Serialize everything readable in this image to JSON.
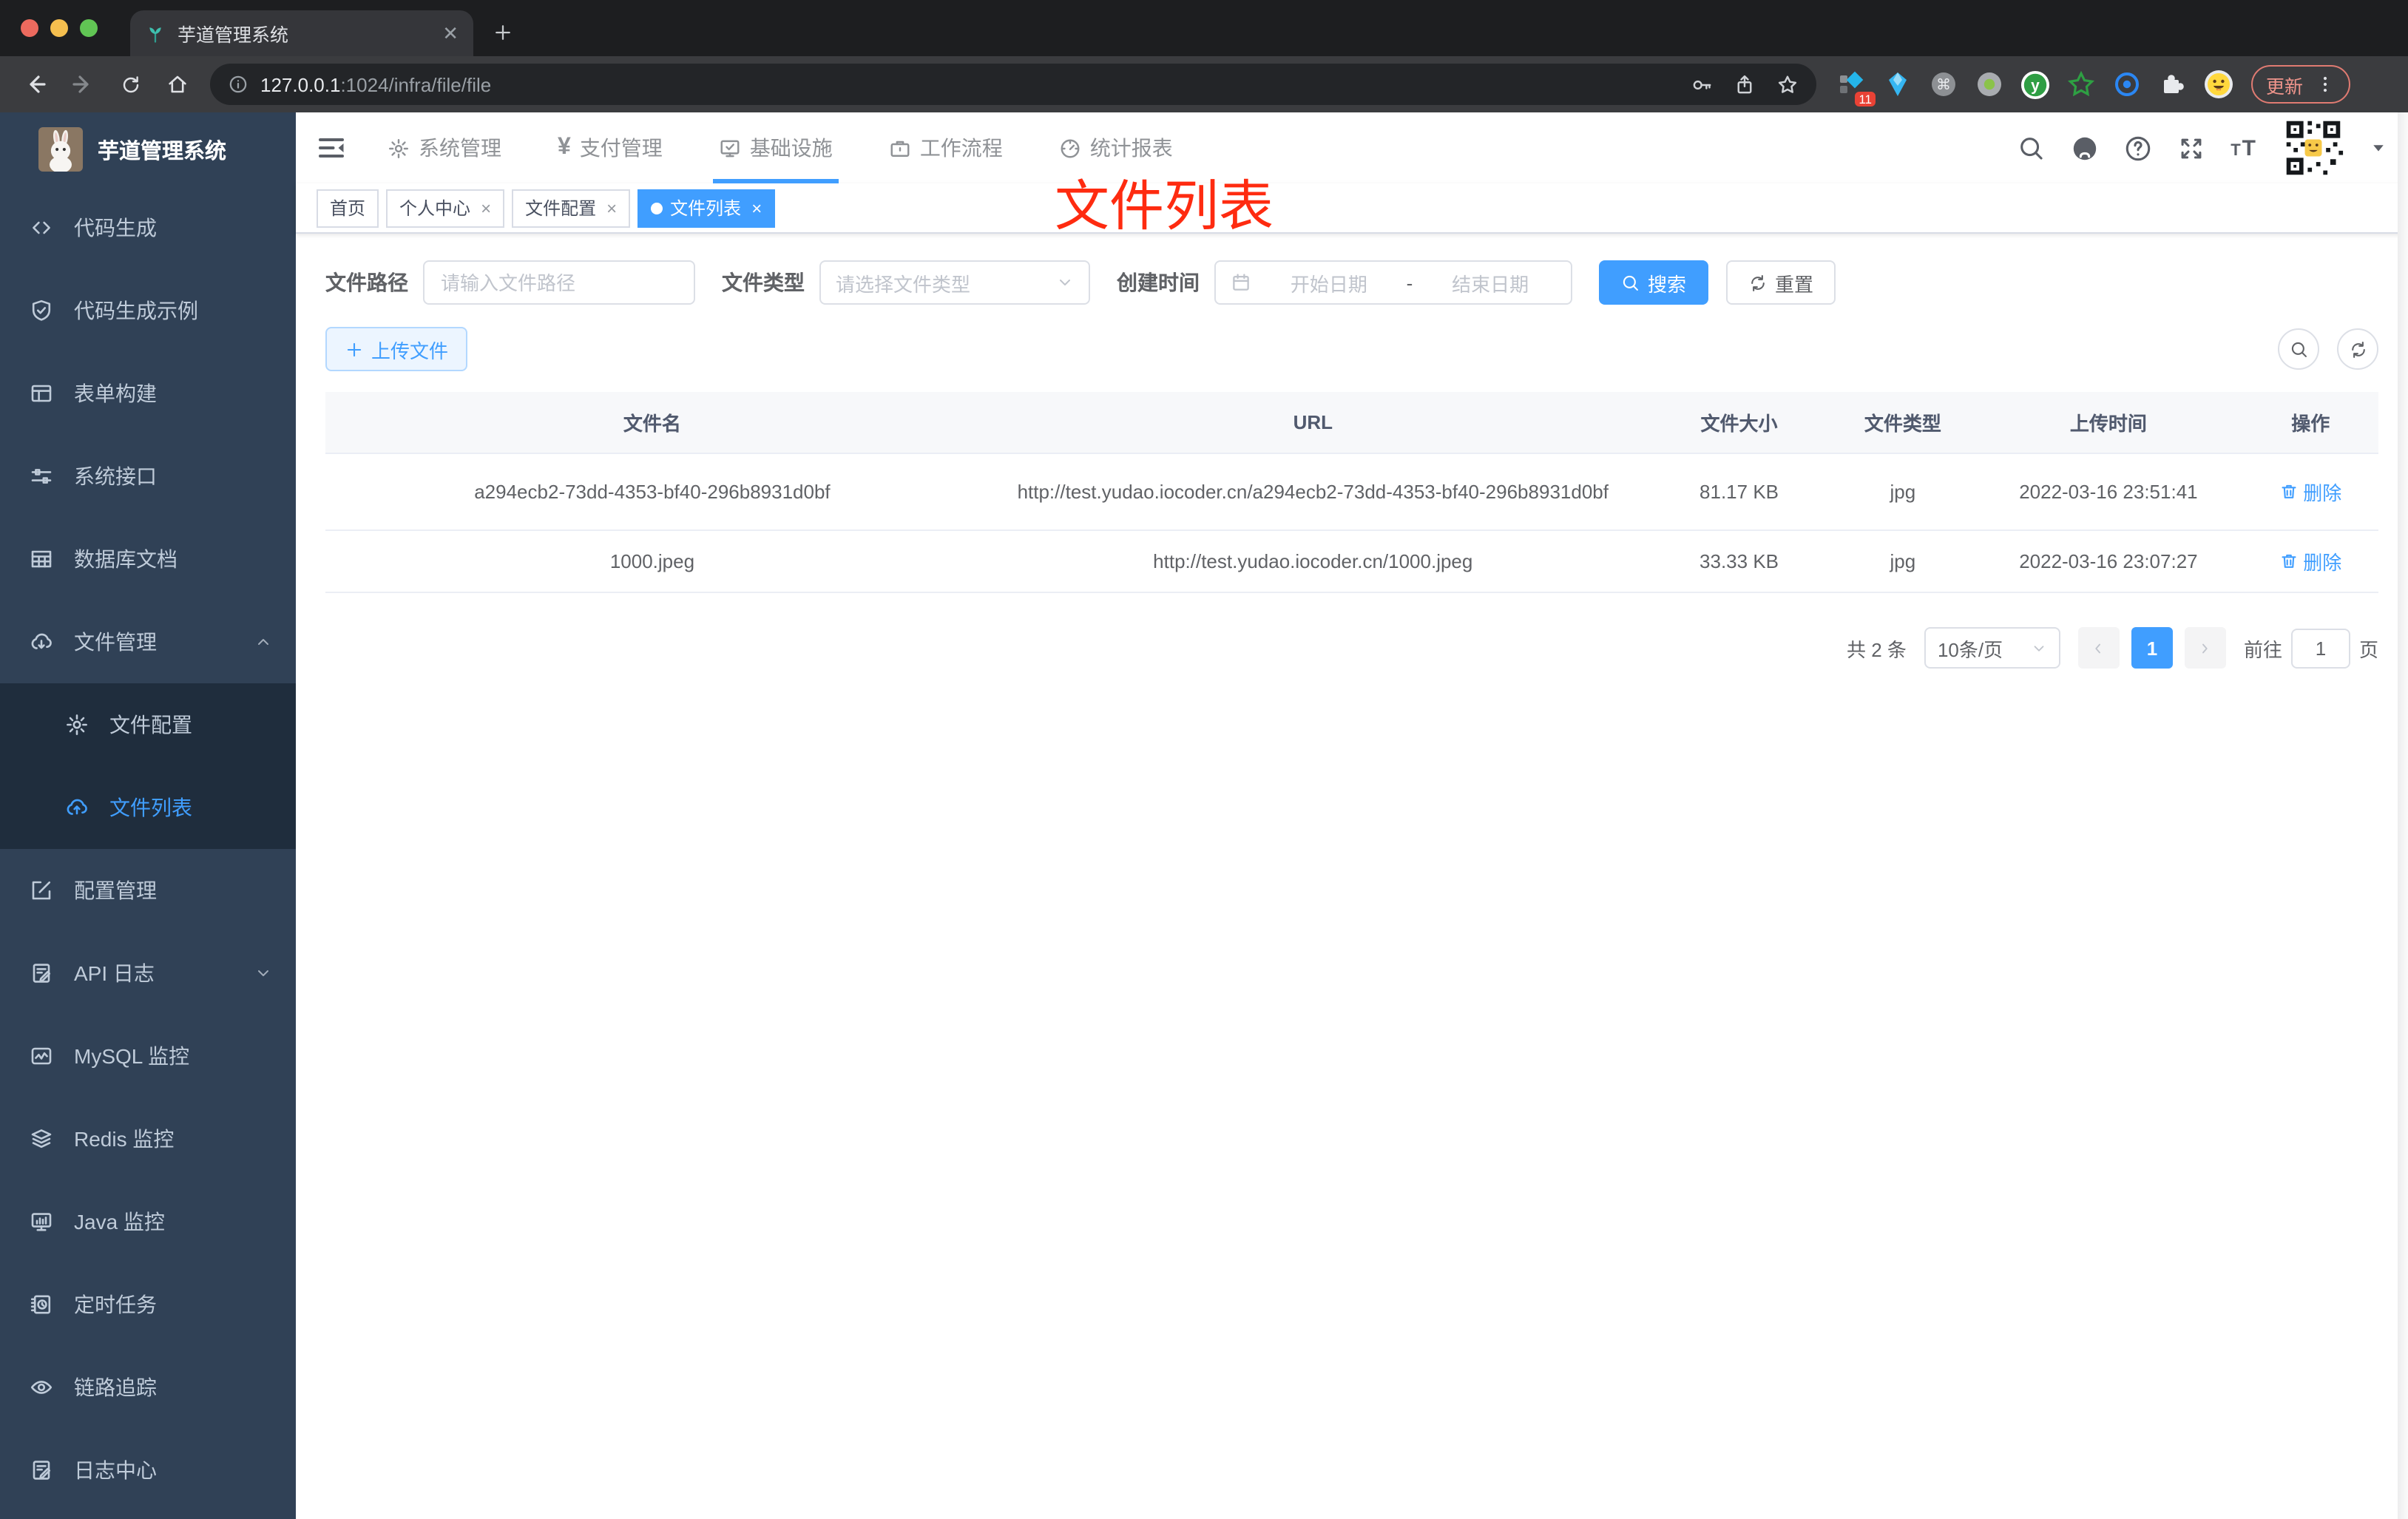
{
  "browser": {
    "tab_title": "芋道管理系统",
    "url_host": "127.0.0.1",
    "url_rest": ":1024/infra/file/file",
    "extensions_badge": "11",
    "update_label": "更新"
  },
  "sidebar": {
    "title": "芋道管理系统",
    "items": [
      {
        "label": "代码生成",
        "icon": "code-icon"
      },
      {
        "label": "代码生成示例",
        "icon": "shield-check-icon"
      },
      {
        "label": "表单构建",
        "icon": "form-icon"
      },
      {
        "label": "系统接口",
        "icon": "sliders-icon"
      },
      {
        "label": "数据库文档",
        "icon": "grid-icon"
      },
      {
        "label": "文件管理",
        "icon": "cloud-download-icon",
        "expanded": true
      },
      {
        "label": "文件配置",
        "icon": "gear-icon",
        "submenu": true
      },
      {
        "label": "文件列表",
        "icon": "cloud-upload-icon",
        "submenu": true,
        "active": true
      },
      {
        "label": "配置管理",
        "icon": "edit-square-icon"
      },
      {
        "label": "API 日志",
        "icon": "log-icon",
        "collapsed": true
      },
      {
        "label": "MySQL 监控",
        "icon": "chart-icon"
      },
      {
        "label": "Redis 监控",
        "icon": "layers-icon"
      },
      {
        "label": "Java 监控",
        "icon": "monitor-icon"
      },
      {
        "label": "定时任务",
        "icon": "schedule-icon"
      },
      {
        "label": "链路追踪",
        "icon": "eye-icon"
      },
      {
        "label": "日志中心",
        "icon": "log-icon"
      }
    ]
  },
  "header": {
    "nav": [
      {
        "label": "系统管理",
        "icon": "gear-icon"
      },
      {
        "label": "支付管理",
        "icon": "yen-icon"
      },
      {
        "label": "基础设施",
        "icon": "infra-icon",
        "active": true
      },
      {
        "label": "工作流程",
        "icon": "briefcase-icon"
      },
      {
        "label": "统计报表",
        "icon": "dashboard-icon"
      }
    ]
  },
  "tags": [
    {
      "label": "首页"
    },
    {
      "label": "个人中心",
      "closable": true
    },
    {
      "label": "文件配置",
      "closable": true
    },
    {
      "label": "文件列表",
      "closable": true,
      "active": true
    }
  ],
  "annotation": {
    "text": "文件列表",
    "color": "#fe2b10"
  },
  "filter": {
    "path_label": "文件路径",
    "path_placeholder": "请输入文件路径",
    "type_label": "文件类型",
    "type_placeholder": "请选择文件类型",
    "time_label": "创建时间",
    "start_placeholder": "开始日期",
    "separator": "-",
    "end_placeholder": "结束日期",
    "search_label": "搜索",
    "reset_label": "重置"
  },
  "toolbar": {
    "upload_label": "上传文件"
  },
  "table": {
    "headers": [
      "文件名",
      "URL",
      "文件大小",
      "文件类型",
      "上传时间",
      "操作"
    ],
    "rows": [
      {
        "name": "a294ecb2-73dd-4353-bf40-296b8931d0bf",
        "url": "http://test.yudao.iocoder.cn/a294ecb2-73dd-4353-bf40-296b8931d0bf",
        "size": "81.17 KB",
        "type": "jpg",
        "time": "2022-03-16 23:51:41",
        "action": "删除"
      },
      {
        "name": "1000.jpeg",
        "url": "http://test.yudao.iocoder.cn/1000.jpeg",
        "size": "33.33 KB",
        "type": "jpg",
        "time": "2022-03-16 23:07:27",
        "action": "删除"
      }
    ]
  },
  "pagination": {
    "total": "共 2 条",
    "page_size": "10条/页",
    "current": "1",
    "goto_label": "前往",
    "goto_value": "1",
    "page_unit": "页"
  },
  "colors": {
    "accent": "#409eff",
    "sidebar_bg": "#304156",
    "submenu_bg": "#1f2d3d",
    "annotation_red": "#fe2b10"
  }
}
